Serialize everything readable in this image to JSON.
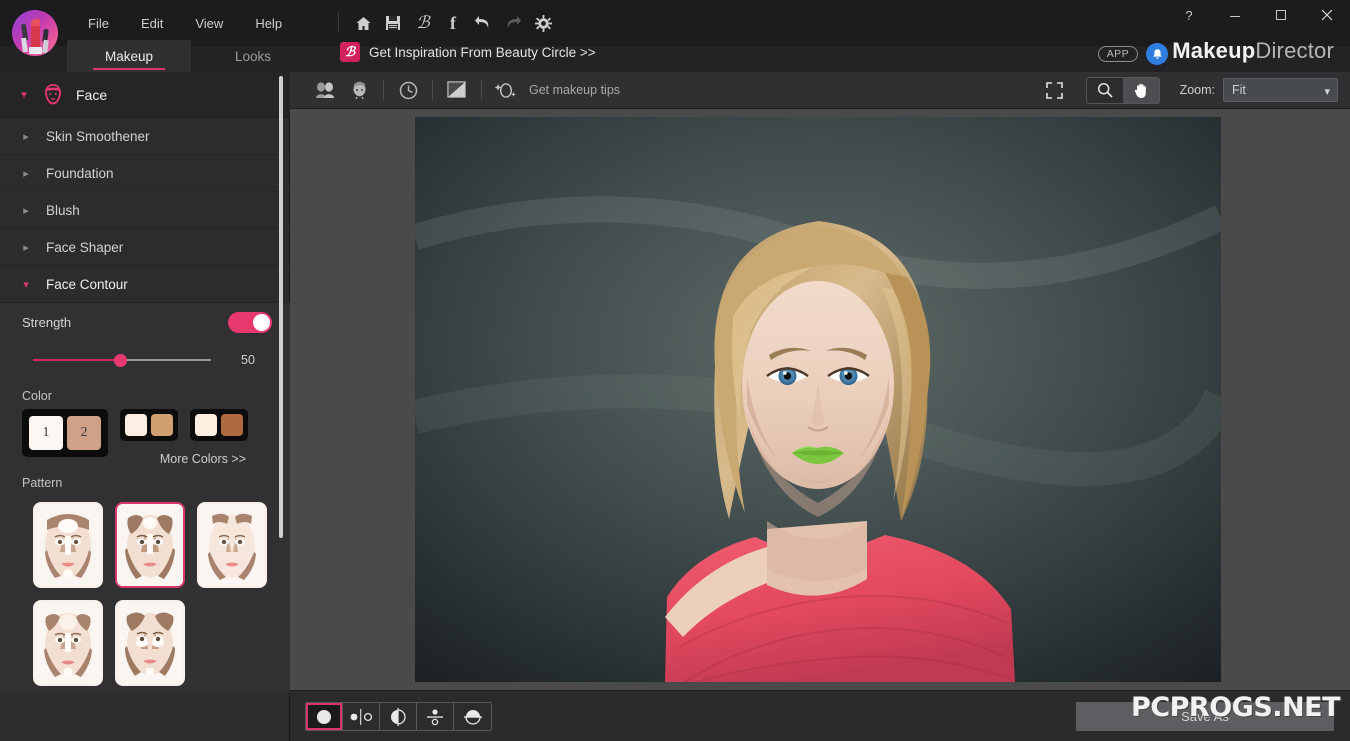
{
  "window": {
    "title": "MakeupDirector",
    "brand_bold": "Makeup",
    "brand_light": "Director",
    "help_label": "?",
    "minimize_label": "—",
    "maximize_label": "☐",
    "close_label": "✕"
  },
  "menu": {
    "items": [
      {
        "label": "File"
      },
      {
        "label": "Edit"
      },
      {
        "label": "View"
      },
      {
        "label": "Help"
      }
    ],
    "icons": [
      {
        "name": "home-icon"
      },
      {
        "name": "save-icon"
      },
      {
        "name": "beauty-circle-icon"
      },
      {
        "name": "facebook-icon"
      },
      {
        "name": "undo-icon"
      },
      {
        "name": "redo-icon"
      },
      {
        "name": "settings-gear-icon"
      }
    ]
  },
  "tabs": [
    {
      "label": "Makeup",
      "active": true
    },
    {
      "label": "Looks",
      "active": false
    }
  ],
  "beauty_circle": {
    "badge": "ℬ",
    "text": "Get Inspiration From Beauty Circle >>"
  },
  "header_right": {
    "app_badge": "APP",
    "bell_icon": "notification-bell-icon"
  },
  "sidebar": {
    "header": {
      "label": "Face",
      "icon": "face-outline-icon"
    },
    "items": [
      {
        "label": "Skin Smoothener",
        "expanded": false
      },
      {
        "label": "Foundation",
        "expanded": false
      },
      {
        "label": "Blush",
        "expanded": false
      },
      {
        "label": "Face Shaper",
        "expanded": false
      },
      {
        "label": "Face Contour",
        "expanded": true
      }
    ],
    "panel": {
      "strength_label": "Strength",
      "strength_value": "50",
      "toggle_on": true,
      "color_label": "Color",
      "more_colors_label": "More Colors >>",
      "pattern_label": "Pattern",
      "selected_pair": {
        "index": 0,
        "colors": [
          "#fdf7f4",
          "#cfa287"
        ],
        "labels": [
          "1",
          "2"
        ]
      },
      "color_pairs": [
        {
          "colors": [
            "#fbeee2",
            "#d0a071"
          ]
        },
        {
          "colors": [
            "#fceee1",
            "#ad6b3f"
          ]
        }
      ],
      "patterns": [
        {
          "id": "pattern-1",
          "selected": false
        },
        {
          "id": "pattern-2",
          "selected": true
        },
        {
          "id": "pattern-3",
          "selected": false
        },
        {
          "id": "pattern-4",
          "selected": false
        },
        {
          "id": "pattern-5",
          "selected": false
        }
      ]
    }
  },
  "canvas_toolbar": {
    "left_icons": [
      {
        "name": "compare-faces-icon"
      },
      {
        "name": "face-detect-icon"
      },
      {
        "name": "history-icon"
      },
      {
        "name": "before-after-icon"
      }
    ],
    "tips_icon": "makeup-tips-icon",
    "tips_label": "Get makeup tips",
    "fullscreen_icon": "fullscreen-icon",
    "tools": [
      {
        "name": "zoom-tool",
        "selected": false
      },
      {
        "name": "hand-tool",
        "selected": true
      }
    ],
    "zoom_label": "Zoom:",
    "zoom_value": "Fit"
  },
  "bottom": {
    "view_modes": [
      {
        "name": "view-single",
        "selected": true
      },
      {
        "name": "view-side-by-side",
        "selected": false
      },
      {
        "name": "view-split-vertical",
        "selected": false
      },
      {
        "name": "view-split-dot",
        "selected": false
      },
      {
        "name": "view-split-horizontal",
        "selected": false
      }
    ],
    "save_as_label": "Save As",
    "watermark": "PCPROGS.NET"
  },
  "colors": {
    "accent_pink": "#e8396f",
    "accent_dark_pink": "#d8356f",
    "titlebar_bg": "#1c1c1e",
    "sidebar_bg": "#2c2c2f",
    "canvas_bg": "#4a4a4a"
  }
}
